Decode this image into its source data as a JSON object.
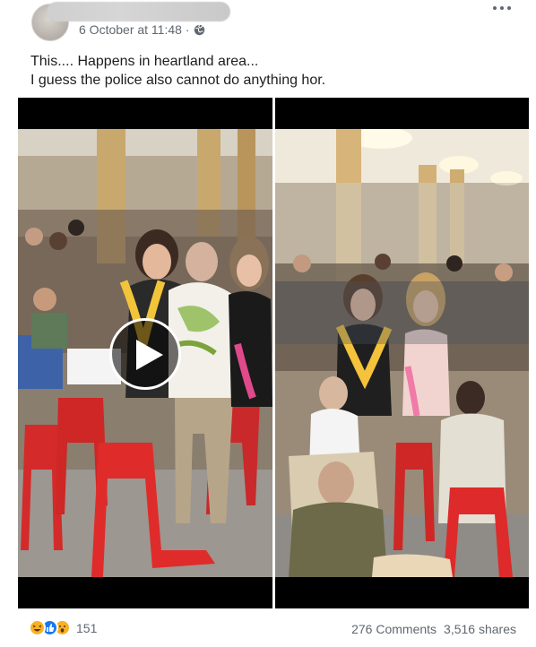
{
  "post": {
    "author_redacted": true,
    "timestamp": "6 October at 11:48 ·",
    "privacy_icon": "globe-icon",
    "more_icon": "more-options-icon",
    "text_lines": [
      "This.... Happens in heartland area...",
      "I guess the police also cannot do anything hor."
    ]
  },
  "media": {
    "left_item": "video-thumbnail",
    "right_item": "photo",
    "play_icon": "play-icon"
  },
  "footer": {
    "reaction_icons": [
      "haha-icon",
      "like-icon",
      "wow-icon"
    ],
    "reaction_count": "151",
    "comments": "276 Comments",
    "shares": "3,516 shares"
  },
  "colors": {
    "text": "#1c1e21",
    "secondary_text": "#616770",
    "like_blue": "#1877f2",
    "reaction_yellow": "#f7b125"
  }
}
